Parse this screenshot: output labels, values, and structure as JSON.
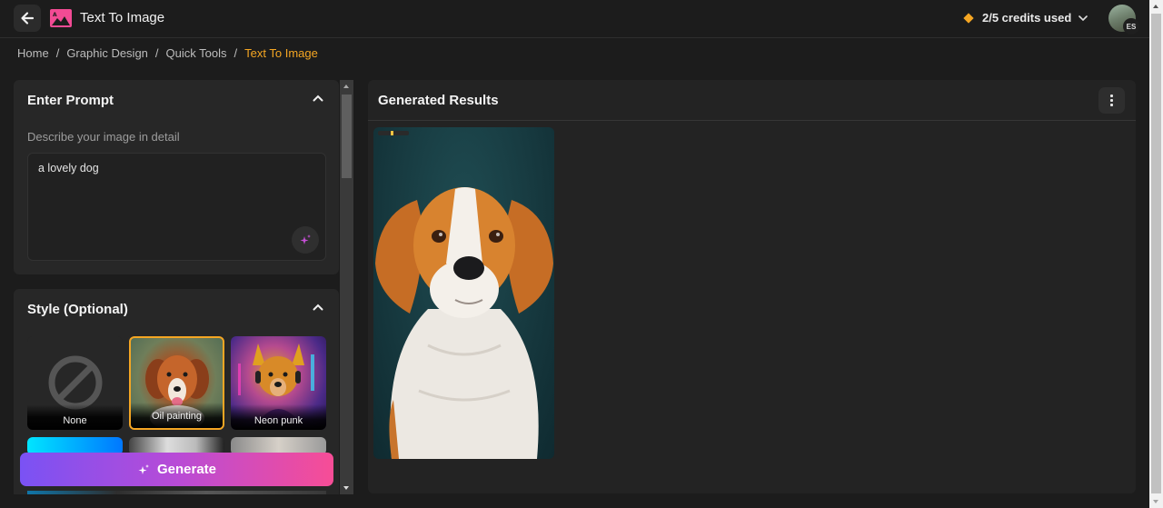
{
  "header": {
    "title": "Text To Image",
    "back_icon": "arrow-left-icon",
    "app_icon": "image-icon",
    "credits_label": "2/5 credits used",
    "credits_icon": "diamond-icon",
    "avatar_initials": "ES"
  },
  "breadcrumb": [
    {
      "label": "Home"
    },
    {
      "label": "Graphic Design"
    },
    {
      "label": "Quick Tools"
    },
    {
      "label": "Text To Image",
      "current": true
    }
  ],
  "prompt_card": {
    "title": "Enter Prompt",
    "field_label": "Describe your image in detail",
    "value": "a lovely dog",
    "magic_icon": "sparkle-icon"
  },
  "style_card": {
    "title": "Style (Optional)",
    "styles": [
      {
        "label": "None",
        "selected": false
      },
      {
        "label": "Oil painting",
        "selected": true
      },
      {
        "label": "Neon punk",
        "selected": false
      }
    ]
  },
  "generate": {
    "label": "Generate",
    "icon": "sparkle-icon"
  },
  "results": {
    "title": "Generated Results",
    "menu_icon": "more-vertical-icon",
    "images": [
      {
        "alt": "Generated oil painting of an orange and white dog"
      }
    ]
  },
  "colors": {
    "accent": "#f5a623",
    "brand_pink": "#f24b94",
    "gradient_start": "#7a52f4",
    "gradient_end": "#f74d96",
    "background": "#1c1c1c",
    "card": "#272727"
  }
}
